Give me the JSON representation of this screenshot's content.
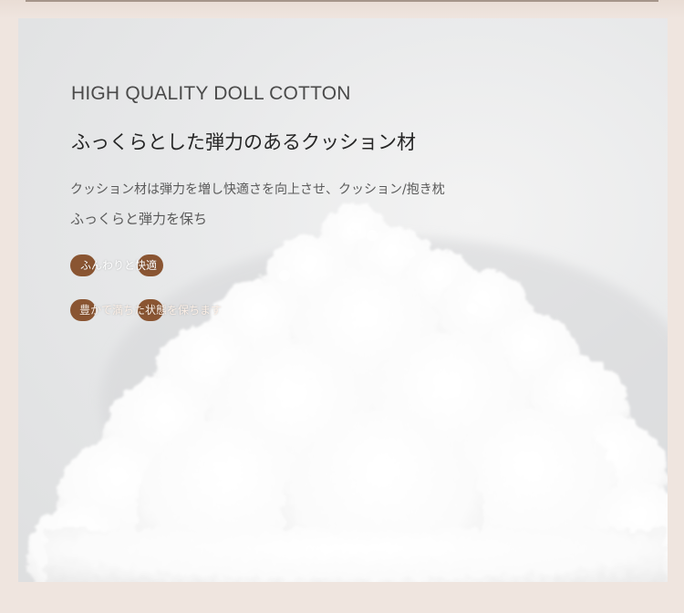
{
  "heading_en": "HIGH QUALITY DOLL COTTON",
  "heading_jp": "ふっくらとした弾力のあるクッション材",
  "description": [
    "クッション材は弾力を増し快適さを向上させ、クッション/抱き枕",
    "ふっくらと弾力を保ち"
  ],
  "features": [
    "ふんわりと快適",
    "豊かで満ちた状態を保ちます"
  ],
  "colors": {
    "page_background": "#efe5df",
    "panel_background": "#e8e9ea",
    "badge": "#8a5532",
    "heading": "#262626"
  },
  "image": "cotton-filling-cloud"
}
